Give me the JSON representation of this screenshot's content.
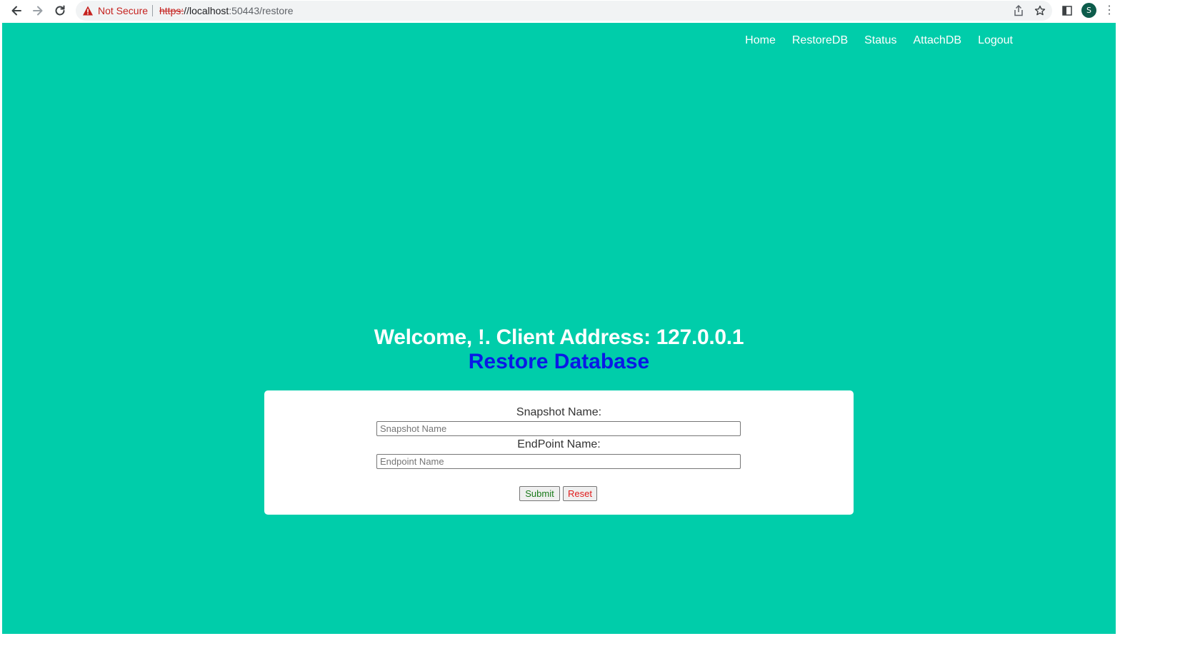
{
  "browser": {
    "security_label": "Not Secure",
    "url_scheme": "https:",
    "url_rest": "//localhost",
    "url_port_path": ":50443/restore",
    "profile_initial": "S"
  },
  "site_nav": {
    "items": [
      {
        "label": "Home"
      },
      {
        "label": "RestoreDB"
      },
      {
        "label": "Status"
      },
      {
        "label": "AttachDB"
      },
      {
        "label": "Logout"
      }
    ]
  },
  "main": {
    "welcome": "Welcome, !. Client Address: 127.0.0.1",
    "title": "Restore Database"
  },
  "form": {
    "snapshot_label": "Snapshot Name:",
    "snapshot_placeholder": "Snapshot Name",
    "snapshot_value": "",
    "endpoint_label": "EndPoint Name:",
    "endpoint_placeholder": "Endpoint Name",
    "endpoint_value": "",
    "submit_label": "Submit",
    "reset_label": "Reset"
  },
  "colors": {
    "page_background": "#00cdaa",
    "title_color": "#0a19e6",
    "submit_text": "#1a7a1a",
    "reset_text": "#e01b1b",
    "warning_red": "#c5221f"
  }
}
